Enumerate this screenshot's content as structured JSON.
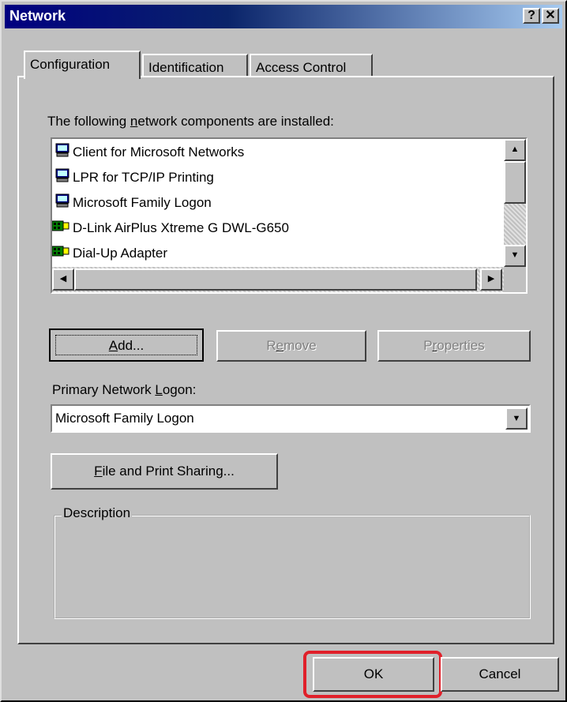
{
  "window": {
    "title": "Network",
    "help_btn": "?",
    "close_btn": "✕"
  },
  "tabs": [
    {
      "label": "Configuration",
      "active": true
    },
    {
      "label": "Identification",
      "active": false
    },
    {
      "label": "Access Control",
      "active": false
    }
  ],
  "components": {
    "label_prefix": "The following ",
    "label_underlined": "n",
    "label_suffix": "etwork components are installed:",
    "items": [
      {
        "label": "Client for Microsoft Networks",
        "icon": "computer-icon"
      },
      {
        "label": "LPR for TCP/IP Printing",
        "icon": "computer-icon"
      },
      {
        "label": "Microsoft Family Logon",
        "icon": "computer-icon"
      },
      {
        "label": "D-Link AirPlus Xtreme G DWL-G650",
        "icon": "network-adapter-icon"
      },
      {
        "label": "Dial-Up Adapter",
        "icon": "network-adapter-icon"
      }
    ]
  },
  "buttons": {
    "add": {
      "u": "A",
      "rest": "dd..."
    },
    "remove": {
      "pre": "R",
      "u": "e",
      "rest": "move"
    },
    "properties": {
      "pre": "P",
      "u": "r",
      "rest": "operties"
    }
  },
  "logon": {
    "label_pre": "Primary Network ",
    "label_u": "L",
    "label_rest": "ogon:",
    "value": "Microsoft Family Logon"
  },
  "sharing": {
    "u": "F",
    "rest": "ile and Print Sharing..."
  },
  "description": {
    "label": "Description"
  },
  "footer": {
    "ok": "OK",
    "cancel": "Cancel"
  },
  "colors": {
    "highlight": "#e0202a",
    "title_start": "#000080",
    "title_end": "#a6caf0"
  }
}
